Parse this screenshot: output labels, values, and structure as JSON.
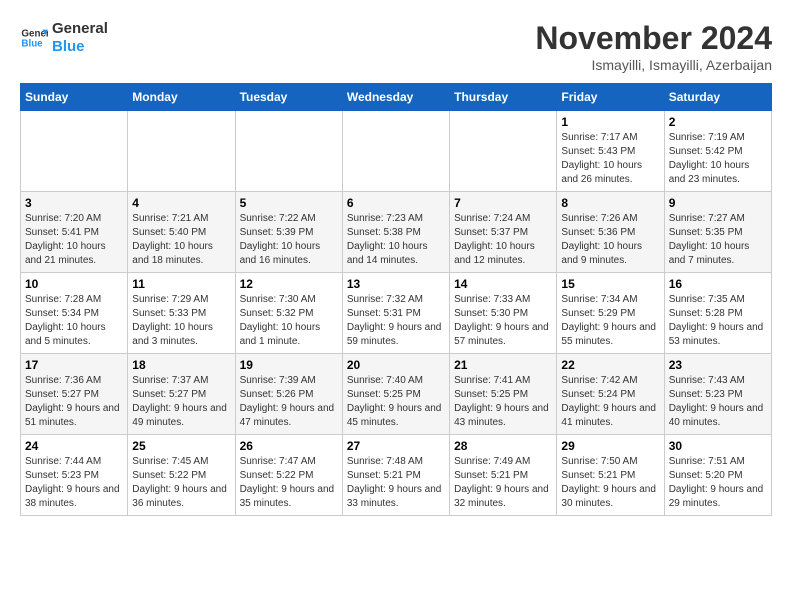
{
  "header": {
    "logo_line1": "General",
    "logo_line2": "Blue",
    "month": "November 2024",
    "location": "Ismayilli, Ismayilli, Azerbaijan"
  },
  "weekdays": [
    "Sunday",
    "Monday",
    "Tuesday",
    "Wednesday",
    "Thursday",
    "Friday",
    "Saturday"
  ],
  "weeks": [
    [
      {
        "day": "",
        "info": ""
      },
      {
        "day": "",
        "info": ""
      },
      {
        "day": "",
        "info": ""
      },
      {
        "day": "",
        "info": ""
      },
      {
        "day": "",
        "info": ""
      },
      {
        "day": "1",
        "info": "Sunrise: 7:17 AM\nSunset: 5:43 PM\nDaylight: 10 hours and 26 minutes."
      },
      {
        "day": "2",
        "info": "Sunrise: 7:19 AM\nSunset: 5:42 PM\nDaylight: 10 hours and 23 minutes."
      }
    ],
    [
      {
        "day": "3",
        "info": "Sunrise: 7:20 AM\nSunset: 5:41 PM\nDaylight: 10 hours and 21 minutes."
      },
      {
        "day": "4",
        "info": "Sunrise: 7:21 AM\nSunset: 5:40 PM\nDaylight: 10 hours and 18 minutes."
      },
      {
        "day": "5",
        "info": "Sunrise: 7:22 AM\nSunset: 5:39 PM\nDaylight: 10 hours and 16 minutes."
      },
      {
        "day": "6",
        "info": "Sunrise: 7:23 AM\nSunset: 5:38 PM\nDaylight: 10 hours and 14 minutes."
      },
      {
        "day": "7",
        "info": "Sunrise: 7:24 AM\nSunset: 5:37 PM\nDaylight: 10 hours and 12 minutes."
      },
      {
        "day": "8",
        "info": "Sunrise: 7:26 AM\nSunset: 5:36 PM\nDaylight: 10 hours and 9 minutes."
      },
      {
        "day": "9",
        "info": "Sunrise: 7:27 AM\nSunset: 5:35 PM\nDaylight: 10 hours and 7 minutes."
      }
    ],
    [
      {
        "day": "10",
        "info": "Sunrise: 7:28 AM\nSunset: 5:34 PM\nDaylight: 10 hours and 5 minutes."
      },
      {
        "day": "11",
        "info": "Sunrise: 7:29 AM\nSunset: 5:33 PM\nDaylight: 10 hours and 3 minutes."
      },
      {
        "day": "12",
        "info": "Sunrise: 7:30 AM\nSunset: 5:32 PM\nDaylight: 10 hours and 1 minute."
      },
      {
        "day": "13",
        "info": "Sunrise: 7:32 AM\nSunset: 5:31 PM\nDaylight: 9 hours and 59 minutes."
      },
      {
        "day": "14",
        "info": "Sunrise: 7:33 AM\nSunset: 5:30 PM\nDaylight: 9 hours and 57 minutes."
      },
      {
        "day": "15",
        "info": "Sunrise: 7:34 AM\nSunset: 5:29 PM\nDaylight: 9 hours and 55 minutes."
      },
      {
        "day": "16",
        "info": "Sunrise: 7:35 AM\nSunset: 5:28 PM\nDaylight: 9 hours and 53 minutes."
      }
    ],
    [
      {
        "day": "17",
        "info": "Sunrise: 7:36 AM\nSunset: 5:27 PM\nDaylight: 9 hours and 51 minutes."
      },
      {
        "day": "18",
        "info": "Sunrise: 7:37 AM\nSunset: 5:27 PM\nDaylight: 9 hours and 49 minutes."
      },
      {
        "day": "19",
        "info": "Sunrise: 7:39 AM\nSunset: 5:26 PM\nDaylight: 9 hours and 47 minutes."
      },
      {
        "day": "20",
        "info": "Sunrise: 7:40 AM\nSunset: 5:25 PM\nDaylight: 9 hours and 45 minutes."
      },
      {
        "day": "21",
        "info": "Sunrise: 7:41 AM\nSunset: 5:25 PM\nDaylight: 9 hours and 43 minutes."
      },
      {
        "day": "22",
        "info": "Sunrise: 7:42 AM\nSunset: 5:24 PM\nDaylight: 9 hours and 41 minutes."
      },
      {
        "day": "23",
        "info": "Sunrise: 7:43 AM\nSunset: 5:23 PM\nDaylight: 9 hours and 40 minutes."
      }
    ],
    [
      {
        "day": "24",
        "info": "Sunrise: 7:44 AM\nSunset: 5:23 PM\nDaylight: 9 hours and 38 minutes."
      },
      {
        "day": "25",
        "info": "Sunrise: 7:45 AM\nSunset: 5:22 PM\nDaylight: 9 hours and 36 minutes."
      },
      {
        "day": "26",
        "info": "Sunrise: 7:47 AM\nSunset: 5:22 PM\nDaylight: 9 hours and 35 minutes."
      },
      {
        "day": "27",
        "info": "Sunrise: 7:48 AM\nSunset: 5:21 PM\nDaylight: 9 hours and 33 minutes."
      },
      {
        "day": "28",
        "info": "Sunrise: 7:49 AM\nSunset: 5:21 PM\nDaylight: 9 hours and 32 minutes."
      },
      {
        "day": "29",
        "info": "Sunrise: 7:50 AM\nSunset: 5:21 PM\nDaylight: 9 hours and 30 minutes."
      },
      {
        "day": "30",
        "info": "Sunrise: 7:51 AM\nSunset: 5:20 PM\nDaylight: 9 hours and 29 minutes."
      }
    ]
  ]
}
